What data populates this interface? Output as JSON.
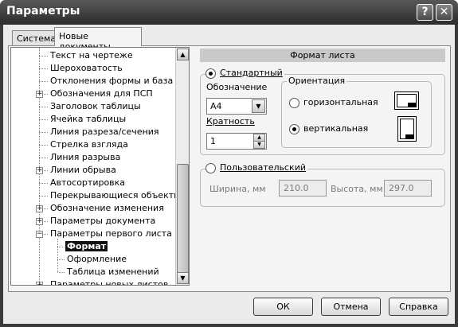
{
  "window": {
    "title": "Параметры",
    "help_glyph": "?",
    "close_glyph": "✕"
  },
  "tabs": [
    {
      "label": "Система"
    },
    {
      "label": "Новые документы"
    }
  ],
  "tree": {
    "items": [
      {
        "label": "Текст на чертеже",
        "expandable": false
      },
      {
        "label": "Шероховатость",
        "expandable": false
      },
      {
        "label": "Отклонения формы и база",
        "expandable": false
      },
      {
        "label": "Обозначения для ПСП",
        "expandable": true
      },
      {
        "label": "Заголовок таблицы",
        "expandable": false
      },
      {
        "label": "Ячейка таблицы",
        "expandable": false
      },
      {
        "label": "Линия разреза/сечения",
        "expandable": false
      },
      {
        "label": "Стрелка взгляда",
        "expandable": false
      },
      {
        "label": "Линия разрыва",
        "expandable": false
      },
      {
        "label": "Линии обрыва",
        "expandable": true
      },
      {
        "label": "Автосортировка",
        "expandable": false
      },
      {
        "label": "Перекрывающиеся объекты",
        "expandable": false
      },
      {
        "label": "Обозначение изменения",
        "expandable": true
      },
      {
        "label": "Параметры документа",
        "expandable": true
      },
      {
        "label": "Параметры первого листа",
        "expandable": true,
        "expanded": true
      },
      {
        "label": "Формат",
        "child": true,
        "selected": true
      },
      {
        "label": "Оформление",
        "child": true
      },
      {
        "label": "Таблица изменений",
        "child": true
      },
      {
        "label": "Параметры новых листов",
        "expandable": true
      }
    ]
  },
  "format_panel": {
    "section_title": "Формат листа",
    "standard": {
      "label": "Стандартный",
      "selected": true,
      "designation_label": "Обозначение",
      "designation_value": "A4",
      "multiplicity_label": "Кратность",
      "multiplicity_value": "1"
    },
    "orientation": {
      "title": "Ориентация",
      "landscape_label": "горизонтальная",
      "portrait_label": "вертикальная",
      "selected": "portrait"
    },
    "custom": {
      "label": "Пользовательский",
      "selected": false,
      "width_label": "Ширина, мм",
      "width_value": "210.0",
      "height_label": "Высота, мм",
      "height_value": "297.0"
    }
  },
  "buttons": {
    "ok": "ОК",
    "cancel": "Отмена",
    "help": "Справка"
  }
}
